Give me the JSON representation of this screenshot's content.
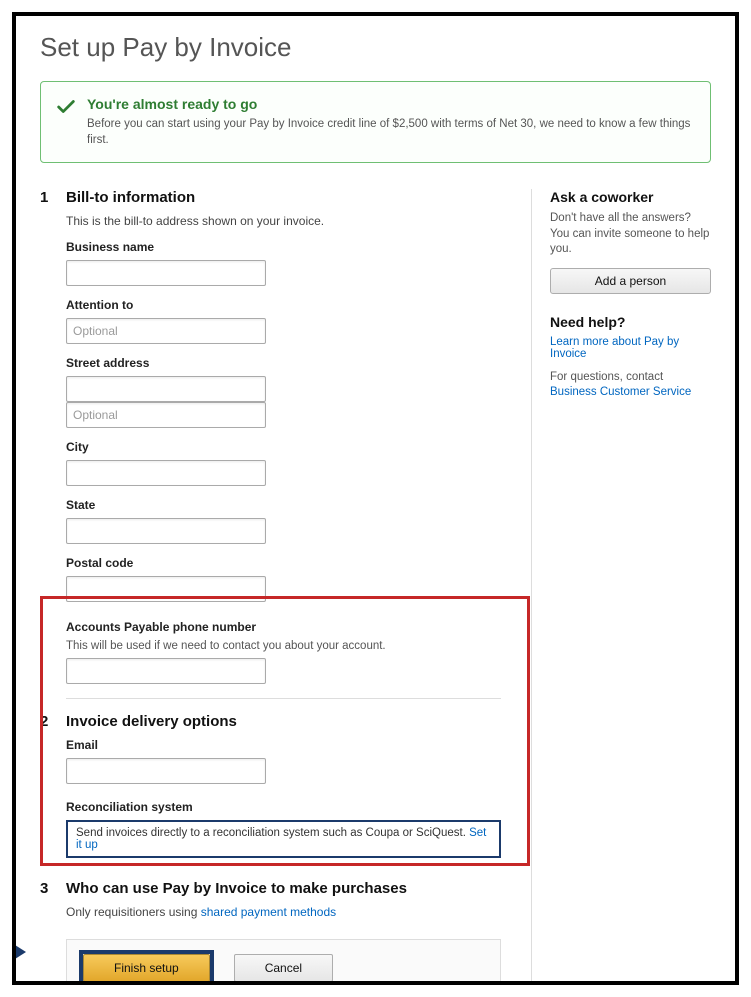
{
  "page": {
    "title": "Set up Pay by Invoice"
  },
  "alert": {
    "title": "You're almost ready to go",
    "text": "Before you can start using your Pay by Invoice credit line of $2,500 with terms of Net 30, we need to know a few things first."
  },
  "section1": {
    "num": "1",
    "title": "Bill-to information",
    "sub": "This is the bill-to address shown on your invoice.",
    "fields": {
      "business_name": {
        "label": "Business name",
        "value": ""
      },
      "attention_to": {
        "label": "Attention to",
        "placeholder": "Optional",
        "value": ""
      },
      "street": {
        "label": "Street address",
        "value": "",
        "value2": "",
        "placeholder2": "Optional"
      },
      "city": {
        "label": "City",
        "value": ""
      },
      "state": {
        "label": "State",
        "value": ""
      },
      "postal": {
        "label": "Postal code",
        "value": ""
      },
      "ap_phone": {
        "label": "Accounts Payable phone number",
        "help": "This will be used if we need to contact you about your account.",
        "value": ""
      }
    }
  },
  "section2": {
    "num": "2",
    "title": "Invoice delivery options",
    "email": {
      "label": "Email",
      "value": ""
    },
    "recon": {
      "label": "Reconciliation system",
      "text": "Send invoices directly to a reconciliation system such as Coupa or SciQuest.",
      "link": "Set it up"
    }
  },
  "section3": {
    "num": "3",
    "title": "Who can use Pay by Invoice to make purchases",
    "text_prefix": "Only requisitioners using ",
    "link": "shared payment methods"
  },
  "sidebar": {
    "ask": {
      "title": "Ask a coworker",
      "text": "Don't have all the answers? You can invite someone to help you.",
      "button": "Add a person"
    },
    "help": {
      "title": "Need help?",
      "learn_link": "Learn more about Pay by Invoice",
      "contact_prefix": "For questions, contact ",
      "contact_link": "Business Customer Service"
    }
  },
  "footer": {
    "finish": "Finish setup",
    "cancel": "Cancel"
  }
}
